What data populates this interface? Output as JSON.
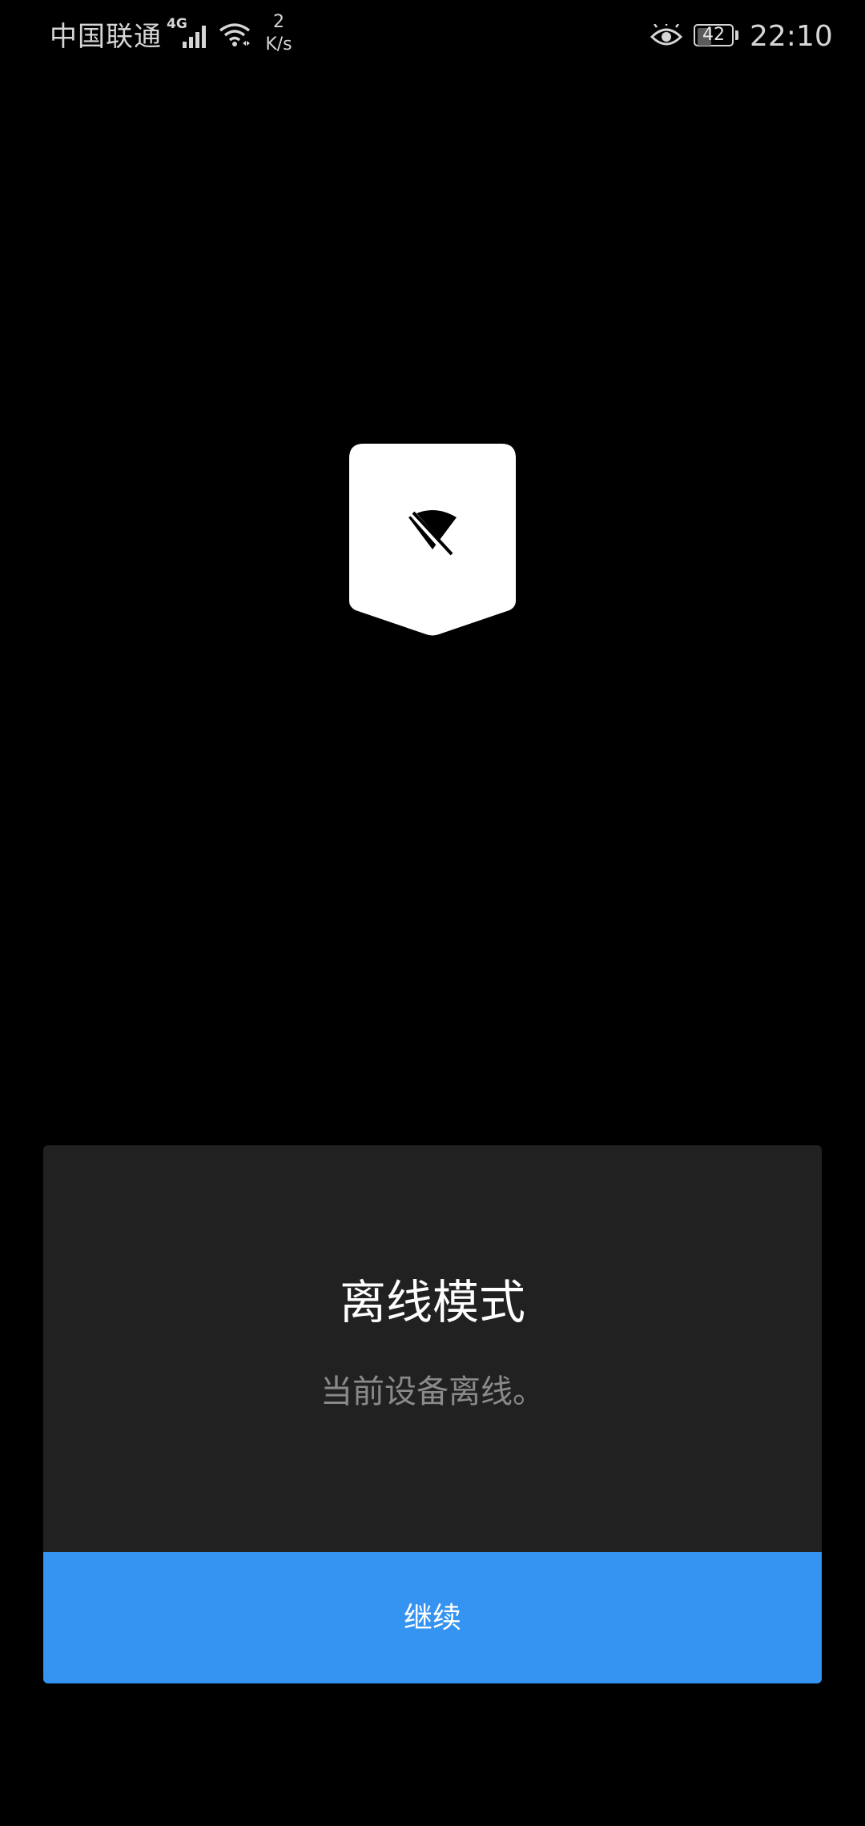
{
  "status_bar": {
    "carrier": "中国联通",
    "network_type": "4G",
    "net_speed_value": "2",
    "net_speed_unit": "K/s",
    "battery_level": "42",
    "time": "22:10",
    "icons": [
      "signal-icon",
      "wifi-icon",
      "eye-icon",
      "battery-icon"
    ]
  },
  "badge": {
    "icon": "wifi-off-icon"
  },
  "dialog": {
    "title": "离线模式",
    "message": "当前设备离线。",
    "continue_label": "继续"
  },
  "colors": {
    "background": "#000000",
    "dialog_bg": "#212121",
    "accent": "#3593f2",
    "message_text": "#8a8a8a"
  }
}
